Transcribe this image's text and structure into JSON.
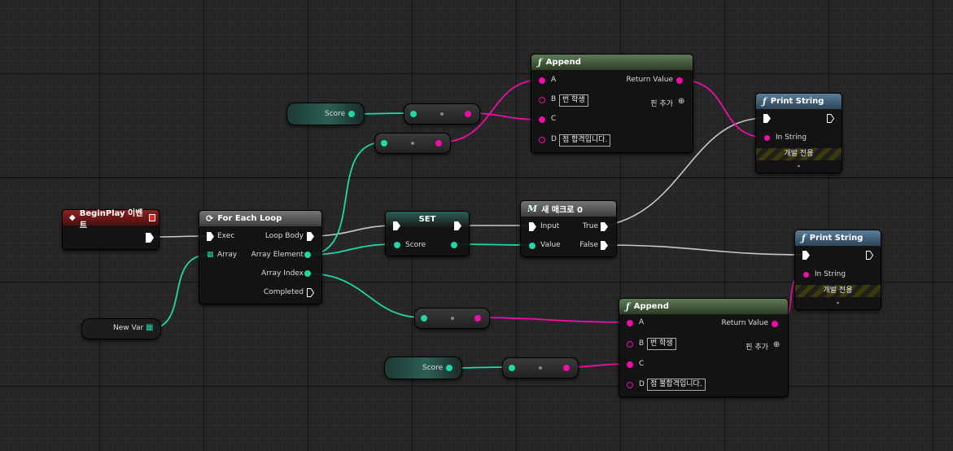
{
  "nodes": {
    "begin_play": {
      "title": "BeginPlay 이벤트"
    },
    "for_each": {
      "title": "For Each Loop",
      "exec": "Exec",
      "array": "Array",
      "loop_body": "Loop Body",
      "array_element": "Array Element",
      "array_index": "Array Index",
      "completed": "Completed"
    },
    "set": {
      "title": "SET",
      "score": "Score"
    },
    "macro": {
      "title": "새 매크로 0",
      "input": "Input",
      "value": "Value",
      "true": "True",
      "false": "False"
    },
    "append_top": {
      "title": "Append",
      "a": "A",
      "b": "B",
      "b_value": "번 학생",
      "c": "C",
      "d": "D",
      "d_value": "점 합격입니다.",
      "return_value": "Return Value",
      "add_pin": "핀 추가"
    },
    "append_bottom": {
      "title": "Append",
      "a": "A",
      "b": "B",
      "b_value": "번 학생",
      "c": "C",
      "d": "D",
      "d_value": "점 불합격입니다.",
      "return_value": "Return Value",
      "add_pin": "핀 추가"
    },
    "print_top": {
      "title": "Print String",
      "in_string": "In String",
      "dev_only": "개발 전용"
    },
    "print_bottom": {
      "title": "Print String",
      "in_string": "In String",
      "dev_only": "개발 전용"
    }
  },
  "variables": {
    "score_top": "Score",
    "score_bottom": "Score",
    "new_var": "New Var"
  },
  "colors": {
    "exec": "#ffffff",
    "string": "#f00ca8",
    "integer": "#1ed8a5",
    "wire_exec": "#c8c8c8"
  },
  "icons": {
    "function": "function-icon",
    "loop": "loop-icon",
    "event": "event-diamond-icon",
    "macro": "macro-icon",
    "array": "array-grid-icon",
    "add_pin": "add-pin-icon"
  }
}
